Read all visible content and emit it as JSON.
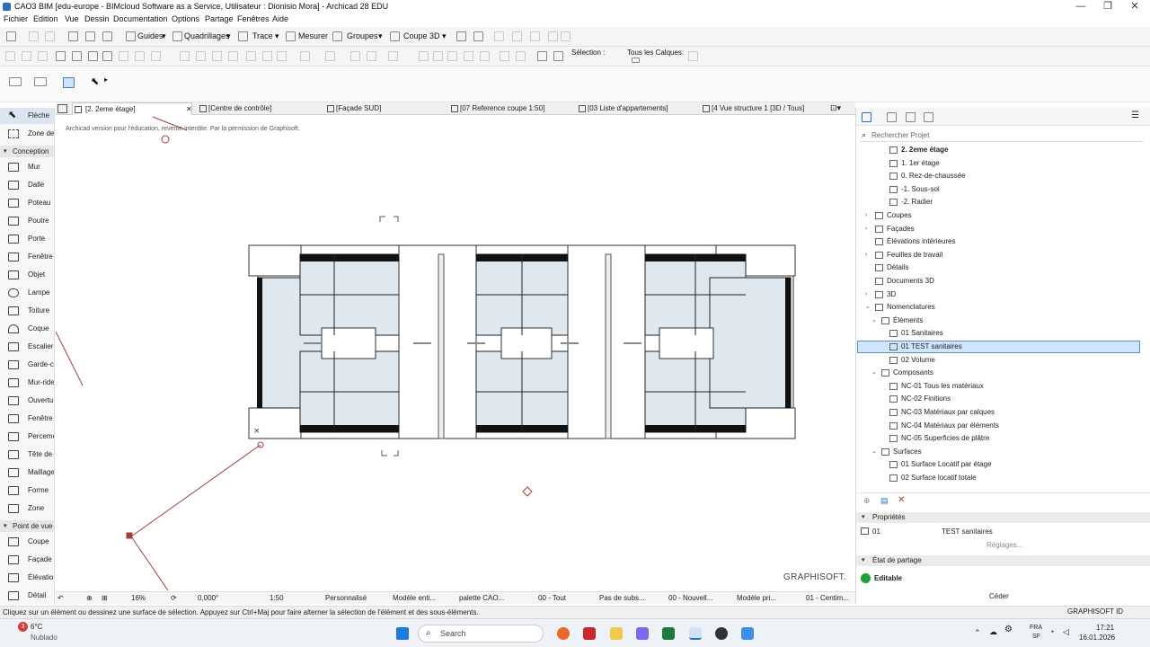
{
  "window": {
    "title": "CAO3 BIM [edu-europe - BIMcloud Software as a Service, Utilisateur : Dionisio Mora] - Archicad 28 EDU",
    "controls": [
      "—",
      "❐",
      "✕"
    ]
  },
  "menu": [
    "Fichier",
    "Edition",
    "Vue",
    "Dessin",
    "Documentation",
    "Options",
    "Partage",
    "Fenêtres",
    "Aide"
  ],
  "toolbar1": {
    "guides": "Guides",
    "grids": "Quadrillages",
    "trace": "Trace",
    "measure": "Mesurer",
    "groups": "Groupes",
    "section3d": "Coupe 3D"
  },
  "toolbar2": {
    "selection_label": "Sélection :",
    "layers_label": "Tous les Calques:"
  },
  "tabs": [
    {
      "label": "[2. 2eme étage]",
      "active": true
    },
    {
      "label": "[Centre de contrôle]"
    },
    {
      "label": "[Façade SUD]"
    },
    {
      "label": "[07 Reference coupe 1:50]"
    },
    {
      "label": "[03 Liste d'appartements]"
    },
    {
      "label": "[4 Vue structure 1 [3D / Tous]"
    }
  ],
  "toolbox": {
    "items": [
      {
        "label": "Flèche",
        "selected": true
      },
      {
        "label": "Zone de"
      }
    ],
    "sections": [
      {
        "title": "Conception",
        "items": [
          "Mur",
          "Dalle",
          "Poteau",
          "Poutre",
          "Porte",
          "Fenêtre",
          "Objet",
          "Lampe",
          "Toiture",
          "Coque",
          "Escalier",
          "Garde-co",
          "Mur-ride",
          "Ouvertu",
          "Fenêtre d",
          "Percemen",
          "Tête de m",
          "Maillage",
          "Forme",
          "Zone"
        ]
      },
      {
        "title": "Point de vue",
        "items": [
          "Coupe",
          "Façade",
          "Élévation",
          "Détail"
        ]
      }
    ]
  },
  "canvas": {
    "watermark": "Archicad version pour l'éducation, revente interdite. Par la permission de Graphisoft.",
    "brand": "GRAPHISOFT."
  },
  "statusbar": {
    "zoom": "16%",
    "angle": "0,000°",
    "scale": "1:50",
    "layer_combo": "Personnalisé",
    "model": "Modèle enti...",
    "palette": "palette CAO...",
    "all": "00 - Tout",
    "substructure": "Pas de subs...",
    "new": "00 - Nouvell...",
    "model_pri": "Modèle pri...",
    "centim": "01 - Centim..."
  },
  "navigator": {
    "search_placeholder": "Rechercher Projet",
    "tree": [
      {
        "label": "2. 2eme étage",
        "level": 3,
        "bold": true
      },
      {
        "label": "1. 1er étage",
        "level": 3
      },
      {
        "label": "0. Rez-de-chaussée",
        "level": 3
      },
      {
        "label": "-1. Sous-sol",
        "level": 3
      },
      {
        "label": "-2. Radier",
        "level": 3
      },
      {
        "label": "Coupes",
        "level": 1,
        "arrow": "›"
      },
      {
        "label": "Façades",
        "level": 1,
        "arrow": "›"
      },
      {
        "label": "Élévations intérieures",
        "level": 1
      },
      {
        "label": "Feuilles de travail",
        "level": 1,
        "arrow": "›"
      },
      {
        "label": "Détails",
        "level": 1
      },
      {
        "label": "Documents 3D",
        "level": 1
      },
      {
        "label": "3D",
        "level": 1,
        "arrow": "›"
      },
      {
        "label": "Nomenclatures",
        "level": 1,
        "arrow": "⌄"
      },
      {
        "label": "Éléments",
        "level": 2,
        "arrow": "⌄"
      },
      {
        "label": "01 Sanitaires",
        "level": 3
      },
      {
        "label": "01 TEST sanitaires",
        "level": 3,
        "selected": true
      },
      {
        "label": "02 Volume",
        "level": 3
      },
      {
        "label": "Composants",
        "level": 2,
        "arrow": "⌄"
      },
      {
        "label": "NC-01 Tous les matériaux",
        "level": 3
      },
      {
        "label": "NC-02 Finitions",
        "level": 3
      },
      {
        "label": "NC-03 Matériaux par calques",
        "level": 3
      },
      {
        "label": "NC-04 Matériaux par éléments",
        "level": 3
      },
      {
        "label": "NC-05 Superficies de plâtre",
        "level": 3
      },
      {
        "label": "Surfaces",
        "level": 2,
        "arrow": "⌄"
      },
      {
        "label": "01 Surface Locatif par étage",
        "level": 3
      },
      {
        "label": "02 Surface locatif totale",
        "level": 3
      }
    ],
    "properties": {
      "title": "Propriétés",
      "id": "01",
      "name": "TEST sanitaires",
      "settings": "Réglages..."
    },
    "sharing": {
      "title": "État de partage",
      "status": "Editable",
      "button": "Céder"
    }
  },
  "hint": "Cliquez sur un élément ou dessinez une surface de sélection. Appuyez sur Ctrl+Maj pour faire alterner la sélection de l'élément et des sous-éléments.",
  "taskbar": {
    "weather_temp": "6°C",
    "weather_desc": "Nublado",
    "weather_badge": "3",
    "search": "Search",
    "graphisoft_id": "GRAPHISOFT ID",
    "lang1": "FRA",
    "lang2": "SF",
    "time": "17:21",
    "date": "16.01.2026"
  },
  "colors": {
    "accent": "#2a6fbd",
    "selection_fill": "#cfe5fb",
    "room_fill": "#dfe8ef",
    "editable_green": "#19a33a",
    "section_line": "#a04040"
  }
}
